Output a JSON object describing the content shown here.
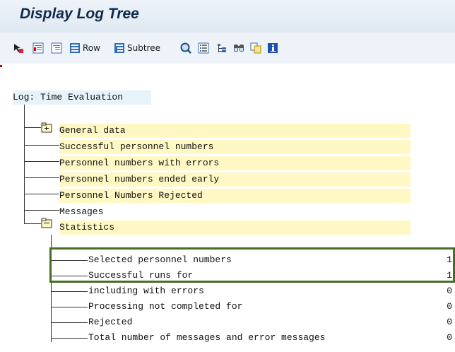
{
  "window": {
    "title": "Display Log Tree"
  },
  "toolbar": {
    "row_label": "Row",
    "subtree_label": "Subtree",
    "icons": [
      "select-icon",
      "expand-icon",
      "collapse-icon",
      "row-icon",
      "subtree-icon",
      "search-icon",
      "list-icon",
      "tree-icon",
      "find-icon",
      "copy-icon",
      "info-icon"
    ]
  },
  "tree": {
    "root_label": "Log: Time Evaluation",
    "nodes": [
      {
        "label": "General data"
      },
      {
        "label": "Successful personnel numbers"
      },
      {
        "label": "Personnel numbers with errors"
      },
      {
        "label": "Personnel numbers ended early"
      },
      {
        "label": "Personnel Numbers Rejected"
      },
      {
        "label": "Messages"
      },
      {
        "label": "Statistics"
      }
    ],
    "statistics": [
      {
        "label": "Selected personnel numbers",
        "value": "1"
      },
      {
        "label": "Successful runs for",
        "value": "1"
      },
      {
        "label": "including with errors",
        "value": "0"
      },
      {
        "label": "Processing not completed for",
        "value": "0"
      },
      {
        "label": "Rejected",
        "value": "0"
      },
      {
        "label": "Total number of messages and error messages",
        "value": "0"
      }
    ]
  },
  "colors": {
    "highlight_box": "#466d24",
    "node_background": "#fff8c4",
    "root_background": "#e6f3f8"
  }
}
